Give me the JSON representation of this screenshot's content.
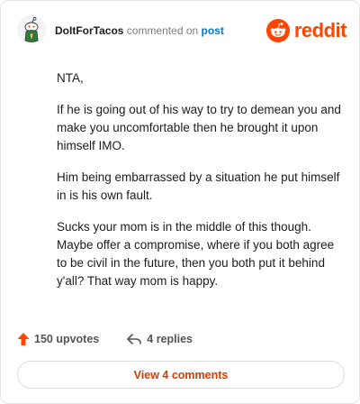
{
  "header": {
    "username": "DoItForTacos",
    "action": "commented on",
    "post_link": "post",
    "brand": "reddit"
  },
  "comment": {
    "paragraphs": [
      "NTA,",
      "If he is going out of his way to try to demean you and make you uncomfortable then he brought it upon himself IMO.",
      "Him being embarrassed by a situation he put himself in is his own fault.",
      "Sucks your mom is in the middle of this though. Maybe offer a compromise, where if you both agree to be civil in the future, then you both put it behind y'all? That way mom is happy."
    ]
  },
  "footer": {
    "upvotes": "150 upvotes",
    "replies": "4 replies",
    "view_comments": "View 4 comments"
  },
  "colors": {
    "accent": "#ff4500",
    "link": "#0079d3",
    "button_text": "#d93a00"
  },
  "icons": {
    "avatar": "snoo-avatar",
    "brand": "reddit-logo-icon",
    "upvote": "upvote-arrow-icon",
    "reply": "reply-arrow-icon"
  }
}
